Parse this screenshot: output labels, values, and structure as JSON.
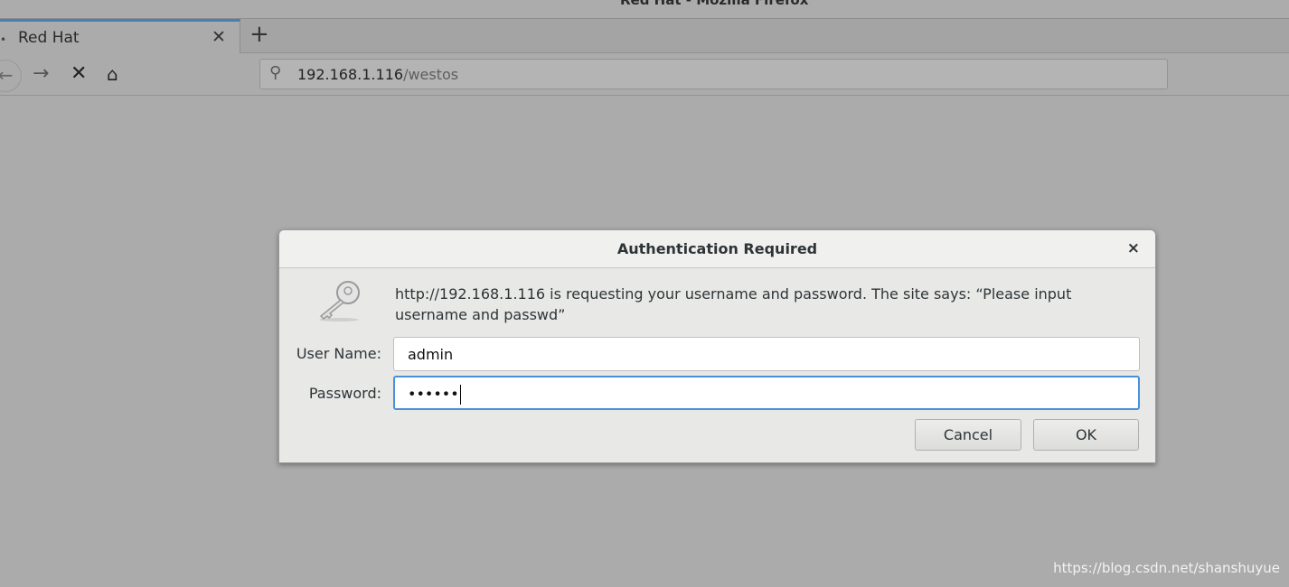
{
  "window": {
    "title": "Red Hat - Mozilla Firefox"
  },
  "tabs": [
    {
      "label": "Red Hat",
      "active": true
    }
  ],
  "toolbar": {
    "new_tab": "+",
    "url_host": "192.168.1.116",
    "url_path": "/westos"
  },
  "dialog": {
    "title": "Authentication Required",
    "message": "http://192.168.1.116 is requesting your username and password. The site says: “Please input username and passwd”",
    "username_label": "User Name:",
    "username_value": "admin",
    "password_label": "Password:",
    "password_value": "••••••",
    "cancel_label": "Cancel",
    "ok_label": "OK"
  },
  "colors": {
    "focus": "#4a90d9",
    "tab_accent": "#4a7fb5"
  },
  "watermark": "https://blog.csdn.net/shanshuyue"
}
